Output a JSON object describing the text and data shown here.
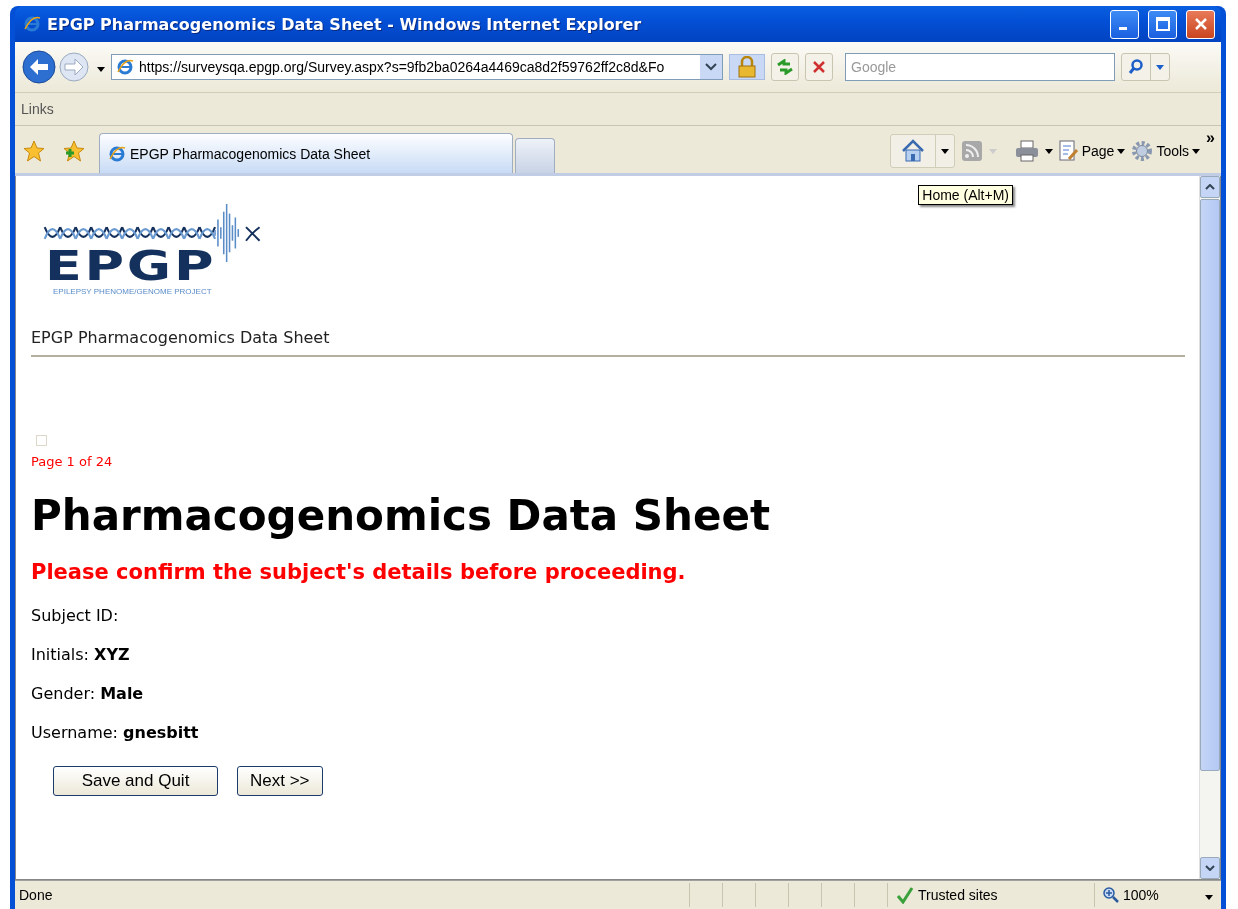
{
  "window": {
    "title": "EPGP Pharmacogenomics Data Sheet - Windows Internet Explorer"
  },
  "address_bar": {
    "url": "https://surveysqa.epgp.org/Survey.aspx?s=9fb2ba0264a4469ca8d2f59762ff2c8d&Fo"
  },
  "search": {
    "placeholder": "Google"
  },
  "links_bar": {
    "label": "Links"
  },
  "tabs": [
    {
      "label": "EPGP Pharmacogenomics Data Sheet",
      "selected": true
    }
  ],
  "command_bar": {
    "items": [
      {
        "kind": "page",
        "label": "Page"
      },
      {
        "kind": "tools",
        "label": "Tools"
      }
    ],
    "overflow": "»"
  },
  "tooltip": {
    "text": "Home (Alt+M)"
  },
  "page": {
    "logo": {
      "wordmark": "EPGP",
      "tagline": "EPILEPSY PHENOME/GENOME PROJECT"
    },
    "header": "EPGP Pharmacogenomics Data Sheet",
    "page_indicator": "Page 1 of 24",
    "heading": "Pharmacogenomics Data Sheet",
    "notice": "Please confirm the subject's details before proceeding.",
    "fields": [
      {
        "label": "Subject ID:"
      },
      {
        "label": "Initials:",
        "value": "XYZ"
      },
      {
        "label": "Gender:",
        "value": "Male"
      },
      {
        "label": "Username:",
        "value": "gnesbitt"
      }
    ],
    "buttons": [
      "Save and Quit",
      "Next >>"
    ]
  },
  "status_bar": {
    "text": "Done",
    "zone": "Trusted sites",
    "zoom": "100%"
  }
}
